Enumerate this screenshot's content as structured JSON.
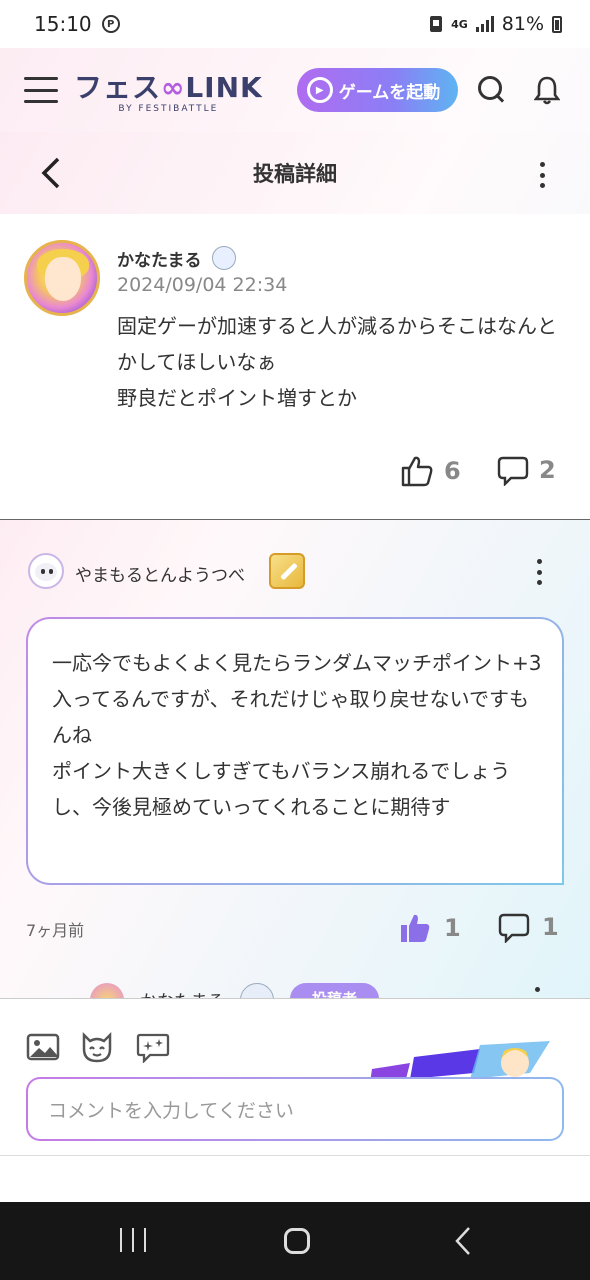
{
  "status_bar": {
    "time": "15:10",
    "network": "4G",
    "battery": "81%"
  },
  "header": {
    "logo_main": "フェス",
    "logo_link": "LINK",
    "logo_sub": "BY FESTIBATTLE",
    "game_button": "ゲームを起動"
  },
  "sub_header": {
    "title": "投稿詳細"
  },
  "post": {
    "author": "かなたまる",
    "date": "2024/09/04 22:34",
    "body": "固定ゲーが加速すると人が減るからそこはなんとかしてほしいなぁ\n野良だとポイント増すとか",
    "likes": "6",
    "comments": "2"
  },
  "comment": {
    "author": "やまもるとんようつべ",
    "body": "一応今でもよくよく見たらランダムマッチポイント+3入ってるんですが、それだけじゃ取り戻せないですもんね\nポイント大きくしすぎてもバランス崩れるでしょうし、今後見極めていってくれることに期待す",
    "time": "7ヶ月前",
    "likes": "1",
    "replies": "1"
  },
  "reply_peek": {
    "author": "かなたまる",
    "tag": "投稿者"
  },
  "composer": {
    "placeholder": "コメントを入力してください"
  },
  "colors": {
    "accent_purple": "#b06cf0",
    "accent_blue": "#5fb4f2",
    "liked_icon": "#8a6fe8"
  }
}
